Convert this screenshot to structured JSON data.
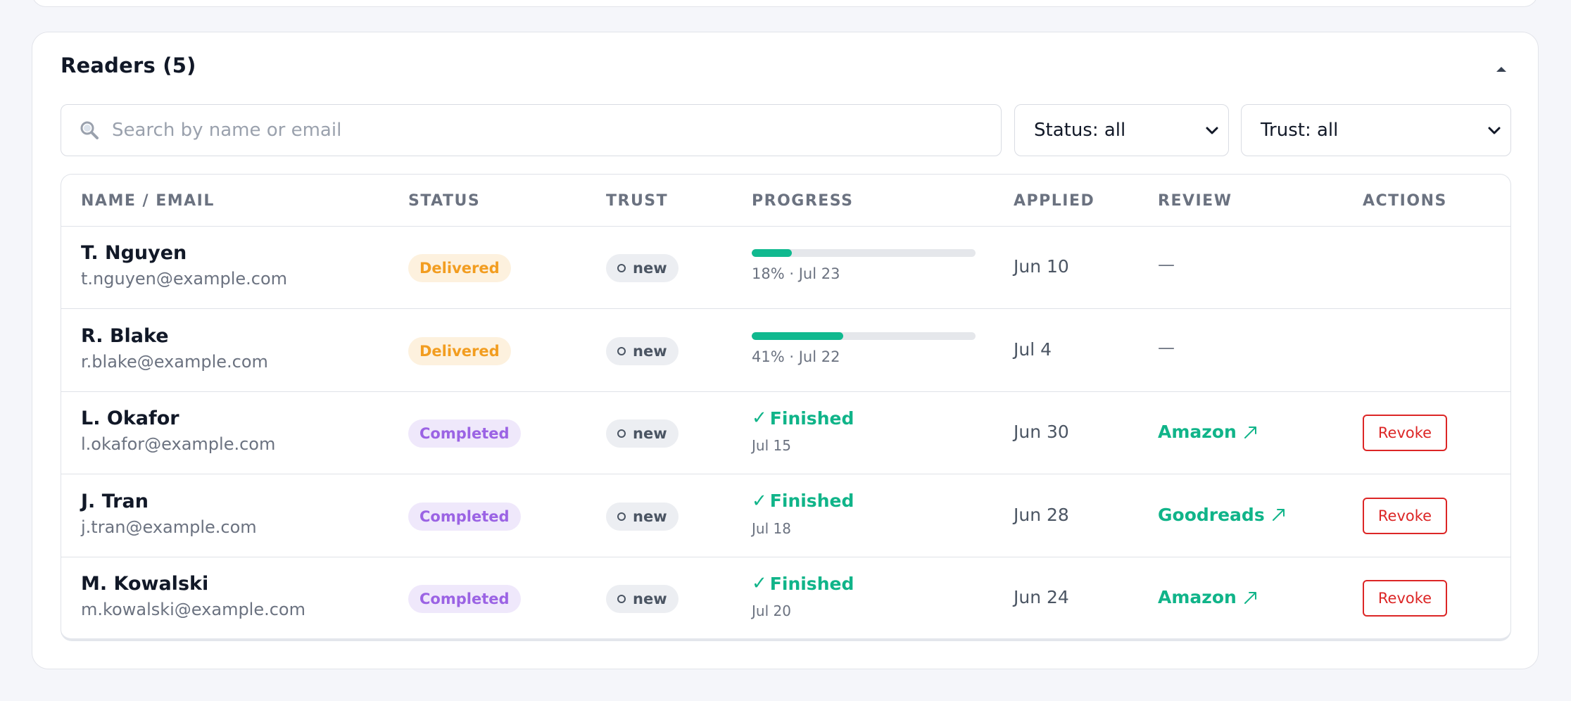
{
  "section": {
    "title": "Readers (5)"
  },
  "search": {
    "placeholder": "Search by name or email",
    "value": ""
  },
  "filters": {
    "status": "Status: all",
    "trust": "Trust: all"
  },
  "columns": [
    "NAME / EMAIL",
    "STATUS",
    "TRUST",
    "PROGRESS",
    "APPLIED",
    "REVIEW",
    "ACTIONS"
  ],
  "colors": {
    "accent": "#10b489",
    "danger": "#dc2626",
    "delivered": "#f29d20",
    "completed": "#9b63e4"
  },
  "rows": [
    {
      "name": "T. Nguyen",
      "email": "t.nguyen@example.com",
      "status": "Delivered",
      "status_kind": "delivered",
      "trust": "new",
      "progress_kind": "bar",
      "progress_pct": 18,
      "progress_text": "18% · Jul 23",
      "applied": "Jun 10",
      "review": "—",
      "review_kind": "none",
      "action": ""
    },
    {
      "name": "R. Blake",
      "email": "r.blake@example.com",
      "status": "Delivered",
      "status_kind": "delivered",
      "trust": "new",
      "progress_kind": "bar",
      "progress_pct": 41,
      "progress_text": "41% · Jul 22",
      "applied": "Jul 4",
      "review": "—",
      "review_kind": "none",
      "action": ""
    },
    {
      "name": "L. Okafor",
      "email": "l.okafor@example.com",
      "status": "Completed",
      "status_kind": "completed",
      "trust": "new",
      "progress_kind": "finished",
      "progress_label": "Finished",
      "progress_text": "Jul 15",
      "applied": "Jun 30",
      "review": "Amazon",
      "review_kind": "link",
      "action": "Revoke"
    },
    {
      "name": "J. Tran",
      "email": "j.tran@example.com",
      "status": "Completed",
      "status_kind": "completed",
      "trust": "new",
      "progress_kind": "finished",
      "progress_label": "Finished",
      "progress_text": "Jul 18",
      "applied": "Jun 28",
      "review": "Goodreads",
      "review_kind": "link",
      "action": "Revoke"
    },
    {
      "name": "M. Kowalski",
      "email": "m.kowalski@example.com",
      "status": "Completed",
      "status_kind": "completed",
      "trust": "new",
      "progress_kind": "finished",
      "progress_label": "Finished",
      "progress_text": "Jul 20",
      "applied": "Jun 24",
      "review": "Amazon",
      "review_kind": "link",
      "action": "Revoke"
    }
  ]
}
